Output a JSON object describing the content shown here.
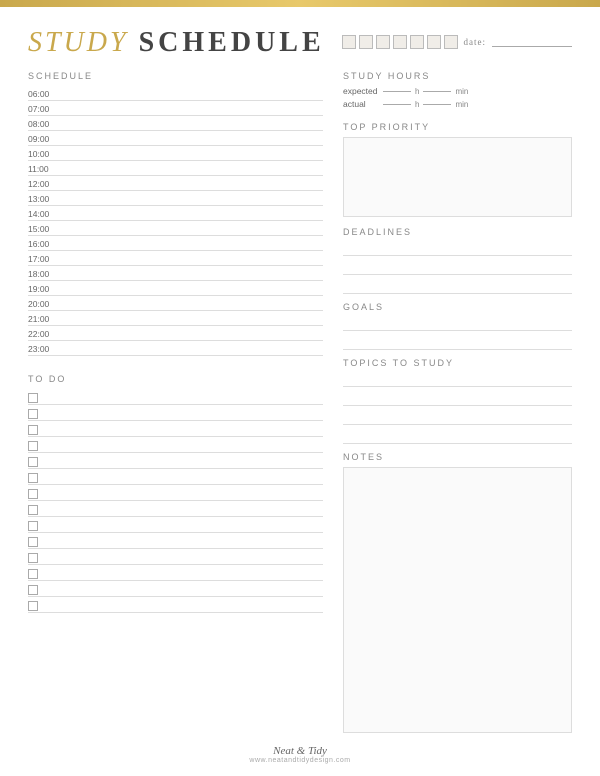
{
  "topbar": {},
  "header": {
    "title_part1": "STUDY",
    "title_part2": "SCHEDULE",
    "date_label": "date:"
  },
  "left": {
    "schedule_label": "SCHEDULE",
    "times": [
      "06:00",
      "07:00",
      "08:00",
      "09:00",
      "10:00",
      "11:00",
      "12:00",
      "13:00",
      "14:00",
      "15:00",
      "16:00",
      "17:00",
      "18:00",
      "19:00",
      "20:00",
      "21:00",
      "22:00",
      "23:00"
    ],
    "todo_label": "TO DO",
    "todo_count": 14
  },
  "right": {
    "study_hours_label": "STUDY HOURS",
    "expected_label": "expected",
    "actual_label": "actual",
    "h_label": "h",
    "min_label": "min",
    "top_priority_label": "TOP PRIORITY",
    "deadlines_label": "DEADLINES",
    "deadlines_lines": 3,
    "goals_label": "GOALS",
    "goals_lines": 2,
    "topics_label": "TOPICS TO STUDY",
    "topics_lines": 4,
    "notes_label": "NOTES"
  },
  "footer": {
    "brand": "Neat & Tidy",
    "url": "www.neatandtidydesign.com"
  }
}
